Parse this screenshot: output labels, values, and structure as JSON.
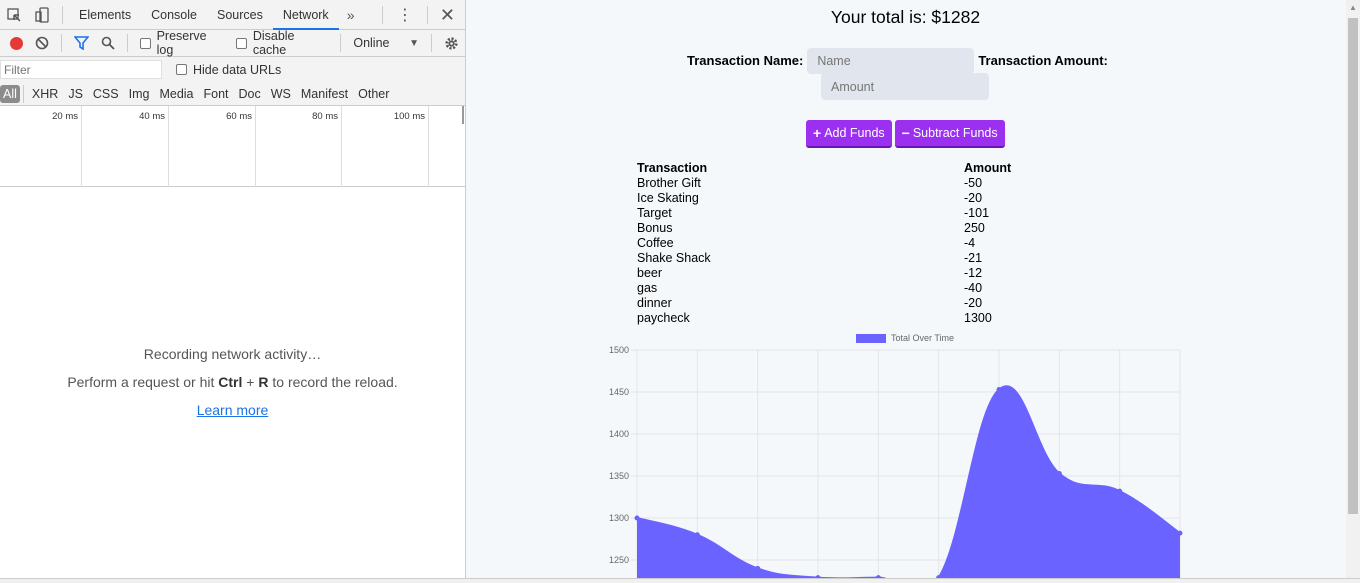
{
  "devtools": {
    "tabs": [
      "Elements",
      "Console",
      "Sources",
      "Network"
    ],
    "active_tab": "Network",
    "more_symbol": "»",
    "toolbar": {
      "preserve_log": "Preserve log",
      "disable_cache": "Disable cache",
      "throttle": "Online"
    },
    "filter_placeholder": "Filter",
    "hide_data_urls": "Hide data URLs",
    "types": [
      "All",
      "XHR",
      "JS",
      "CSS",
      "Img",
      "Media",
      "Font",
      "Doc",
      "WS",
      "Manifest",
      "Other"
    ],
    "ticks": [
      "20 ms",
      "40 ms",
      "60 ms",
      "80 ms",
      "100 ms"
    ],
    "empty": {
      "line1": "Recording network activity…",
      "line2_prefix": "Perform a request or hit ",
      "ctrl": "Ctrl",
      "plus": " + ",
      "r": "R",
      "line2_suffix": " to record the reload.",
      "learn_more": "Learn more"
    }
  },
  "app": {
    "total": "Your total is: $1282",
    "name_label": "Transaction Name:",
    "name_placeholder": "Name",
    "amount_label": "Transaction Amount:",
    "amount_placeholder": "Amount",
    "add_button": "Add Funds",
    "subtract_button": "Subtract Funds",
    "table_headers": [
      "Transaction",
      "Amount"
    ],
    "transactions": [
      {
        "name": "Brother Gift",
        "amount": "-50"
      },
      {
        "name": "Ice Skating",
        "amount": "-20"
      },
      {
        "name": "Target",
        "amount": "-101"
      },
      {
        "name": "Bonus",
        "amount": "250"
      },
      {
        "name": "Coffee",
        "amount": "-4"
      },
      {
        "name": "Shake Shack",
        "amount": "-21"
      },
      {
        "name": "beer",
        "amount": "-12"
      },
      {
        "name": "gas",
        "amount": "-40"
      },
      {
        "name": "dinner",
        "amount": "-20"
      },
      {
        "name": "paycheck",
        "amount": "1300"
      }
    ]
  },
  "colors": {
    "accent": "#9b30f0",
    "chart_fill": "#6b63ff",
    "record": "#e53935",
    "link": "#1a73e8"
  },
  "chart_data": {
    "type": "area",
    "legend": "Total Over Time",
    "legend_position": "top-center",
    "y_ticks": [
      1500,
      1450,
      1400,
      1350,
      1300,
      1250
    ],
    "ylim": [
      1230,
      1500
    ],
    "grid": true,
    "series": [
      {
        "name": "Total Over Time",
        "values": [
          1300,
          1280,
          1240,
          1229,
          1229,
          1229,
          1453,
          1353,
          1332,
          1282
        ]
      }
    ]
  }
}
